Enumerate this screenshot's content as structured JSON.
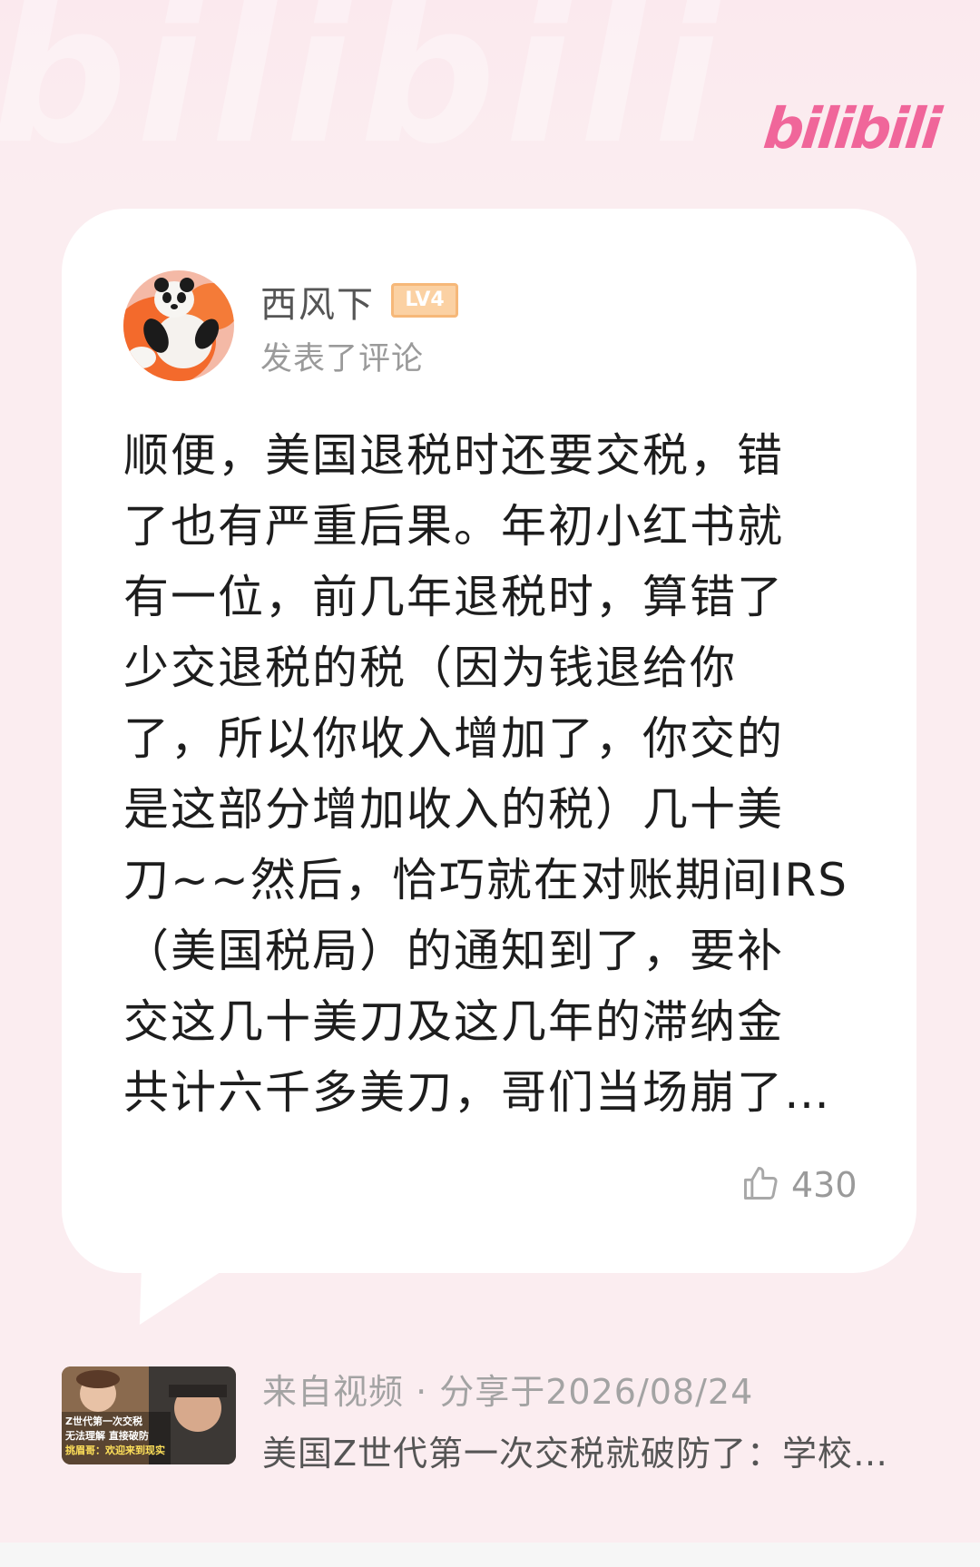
{
  "brand": {
    "logo_text": "bilibili"
  },
  "comment": {
    "username": "西风下",
    "level": "LV4",
    "action": "发表了评论",
    "text_lines": [
      "顺便，美国退税时还要交税，错",
      "了也有严重后果。年初小红书就",
      "有一位，前几年退税时，算错了",
      "少交退税的税（因为钱退给你",
      "了，所以你收入增加了，你交的",
      "是这部分增加收入的税）几十美",
      "刀~~然后，恰巧就在对账期间IRS",
      "（美国税局）的通知到了，要补",
      "交这几十美刀及这几年的滞纳金",
      "共计六千多美刀，哥们当场崩了…"
    ],
    "likes": "430"
  },
  "video": {
    "source_label": "来自视频 · 分享于2026/08/24",
    "title": "美国Z世代第一次交税就破防了：学校…",
    "thumbnail_caption_1": "Z世代第一次交税",
    "thumbnail_caption_2": "无法理解 直接破防",
    "thumbnail_caption_3": "挑眉哥：欢迎来到现实"
  },
  "colors": {
    "background": "#fbedf0",
    "brand_pink": "#f0669a",
    "level_badge": "#fbd1a3",
    "meta_gray": "#9a9a9a"
  }
}
